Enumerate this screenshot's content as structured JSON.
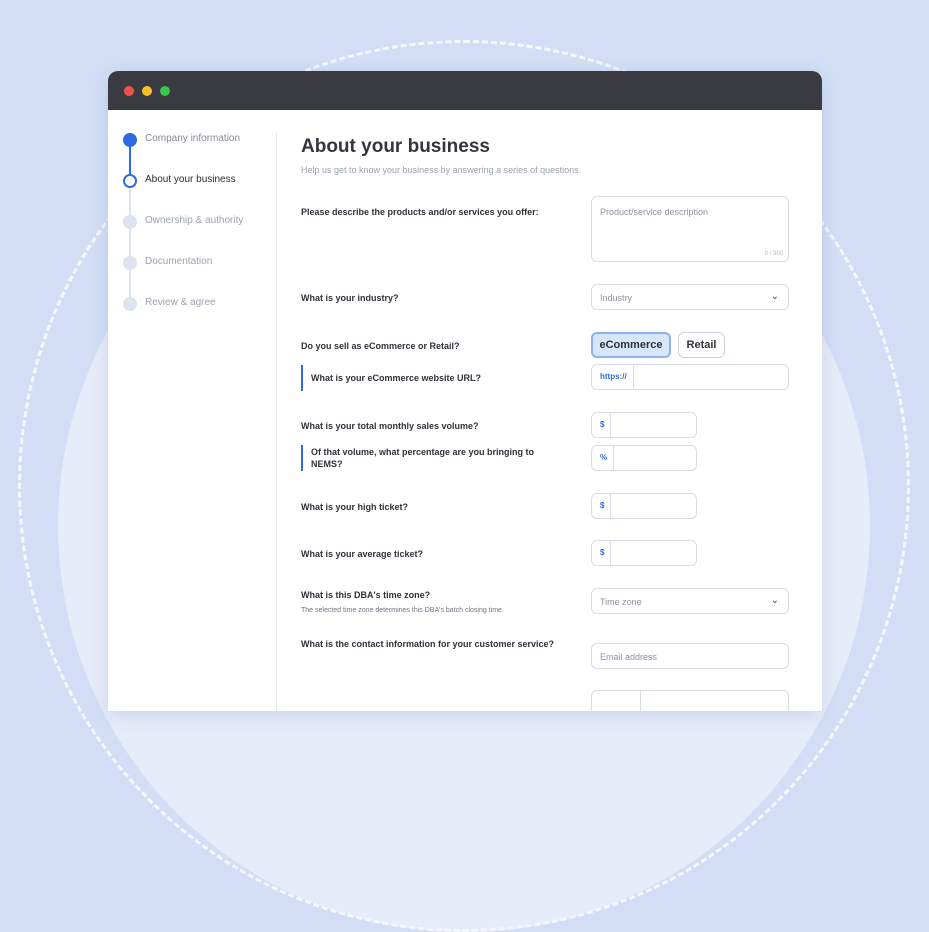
{
  "steps": [
    {
      "label": "Company information",
      "state": "done"
    },
    {
      "label": "About your business",
      "state": "current"
    },
    {
      "label": "Ownership & authority",
      "state": "todo"
    },
    {
      "label": "Documentation",
      "state": "todo"
    },
    {
      "label": "Review & agree",
      "state": "todo"
    }
  ],
  "page": {
    "title": "About your business",
    "subtitle": "Help us get to know your business by answering a series of questions."
  },
  "questions": {
    "products": "Please describe the products and/or services you offer:",
    "industry": "What is your industry?",
    "sell_type": "Do you sell as eCommerce or Retail?",
    "ecommerce_url": "What is your eCommerce website URL?",
    "monthly_volume": "What is your total monthly sales volume?",
    "percentage": "Of that volume, what percentage are you bringing to NEMS?",
    "high_ticket": "What is your high ticket?",
    "average_ticket": "What is your average ticket?",
    "time_zone": "What is this DBA's time zone?",
    "time_zone_note": "The selected time zone determines this DBA's batch closing time.",
    "contact": "What is the contact information for your customer service?"
  },
  "fields": {
    "description_placeholder": "Product/service description",
    "description_count": "0 / 300",
    "industry_placeholder": "Industry",
    "ecommerce_label": "eCommerce",
    "retail_label": "Retail",
    "url_prefix": "https://",
    "dollar_prefix": "$",
    "percent_prefix": "%",
    "time_zone_placeholder": "Time zone",
    "email_placeholder": "Email address"
  },
  "icons": {
    "select_chevron": "chevron-down-icon"
  },
  "colors": {
    "accent": "#2d6ae3",
    "background": "#d3def6",
    "titlebar": "#3a3b40"
  }
}
